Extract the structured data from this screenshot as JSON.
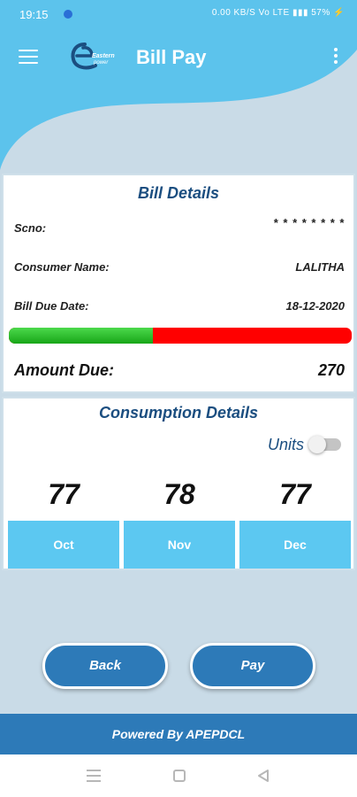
{
  "status_bar": {
    "time": "19:15",
    "indicators": "0.00 KB/S  Vo LTE  ▮▮▮ 57% ⚡"
  },
  "header": {
    "title": "Bill Pay",
    "logo_icon": "eastern-power-logo",
    "menu_icon": "hamburger-menu-icon",
    "more_icon": "more-vert-icon"
  },
  "bill_details": {
    "title": "Bill Details",
    "scno_label": "Scno:",
    "scno_value": "* * * * * * * *",
    "consumer_label": "Consumer Name:",
    "consumer_value": "LALITHA",
    "due_date_label": "Bill Due Date:",
    "due_date_value": "18-12-2020",
    "progress_fraction": 0.42,
    "amount_label": "Amount Due:",
    "amount_value": "270"
  },
  "consumption": {
    "title": "Consumption Details",
    "units_label": "Units",
    "units_toggle_on": false,
    "months": [
      {
        "value": "77",
        "month": "Oct"
      },
      {
        "value": "78",
        "month": "Nov"
      },
      {
        "value": "77",
        "month": "Dec"
      }
    ]
  },
  "actions": {
    "back_label": "Back",
    "pay_label": "Pay"
  },
  "footer": {
    "text": "Powered By APEPDCL"
  },
  "colors": {
    "primary_light": "#5cc3ec",
    "primary_dark": "#2d7ab8",
    "title_blue": "#1b4e80",
    "progress_paid": "#18a618",
    "progress_due": "#ff0000"
  }
}
